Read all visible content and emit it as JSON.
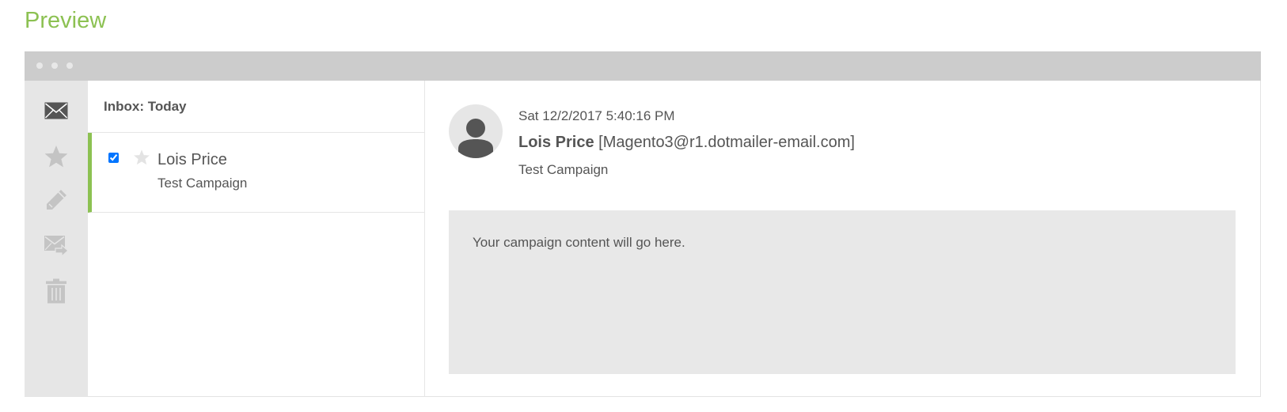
{
  "page": {
    "title": "Preview"
  },
  "colors": {
    "accent": "#8cc152",
    "titlebar": "#cccccc",
    "rail": "#e6e6e6",
    "content_bg": "#e8e8e8",
    "text": "#555555"
  },
  "window": {
    "titlebar_dots": [
      "dot",
      "dot",
      "dot"
    ]
  },
  "rail": {
    "icons": [
      "inbox-icon",
      "starred-icon",
      "compose-icon",
      "forward-icon",
      "trash-icon"
    ]
  },
  "list": {
    "header": "Inbox: Today",
    "items": [
      {
        "sender": "Lois Price",
        "subject": "Test Campaign",
        "checked": true,
        "selected": true
      }
    ]
  },
  "message": {
    "date": "Sat 12/2/2017 5:40:16 PM",
    "from_name": "Lois Price",
    "from_email": "[Magento3@r1.dotmailer-email.com]",
    "subject": "Test Campaign",
    "body": "Your campaign content will go here."
  }
}
